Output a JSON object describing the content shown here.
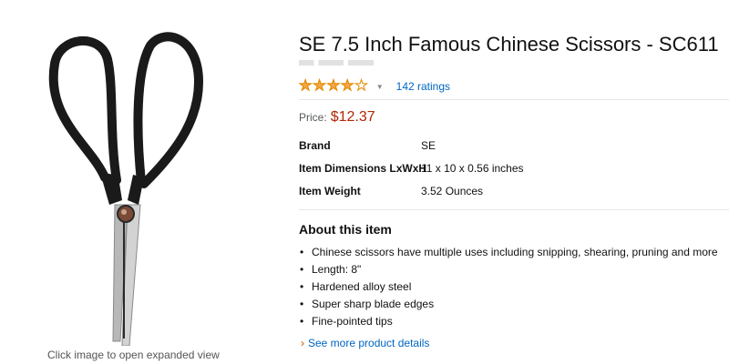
{
  "product": {
    "title": "SE 7.5 Inch Famous Chinese Scissors - SC611",
    "rating": {
      "stars": 4,
      "out_of": 5,
      "count_text": "142 ratings"
    },
    "price": {
      "label": "Price:",
      "value": "$12.37"
    },
    "specs": [
      {
        "key": "Brand",
        "value": "SE"
      },
      {
        "key": "Item Dimensions LxWxH",
        "value": "11 x 10 x 0.56 inches"
      },
      {
        "key": "Item Weight",
        "value": "3.52 Ounces"
      }
    ],
    "about": {
      "title": "About this item",
      "bullets": [
        "Chinese scissors have multiple uses including snipping, shearing, pruning and more",
        "Length: 8\"",
        "Hardened alloy steel",
        "Super sharp blade edges",
        "Fine-pointed tips"
      ]
    },
    "more_link": "See more product details"
  },
  "gallery": {
    "caption": "Click image to open expanded view",
    "image_icon": "scissors-icon"
  },
  "colors": {
    "price": "#b12704",
    "link": "#0066c0",
    "star": "#f3a847",
    "chevron": "#c45500"
  }
}
